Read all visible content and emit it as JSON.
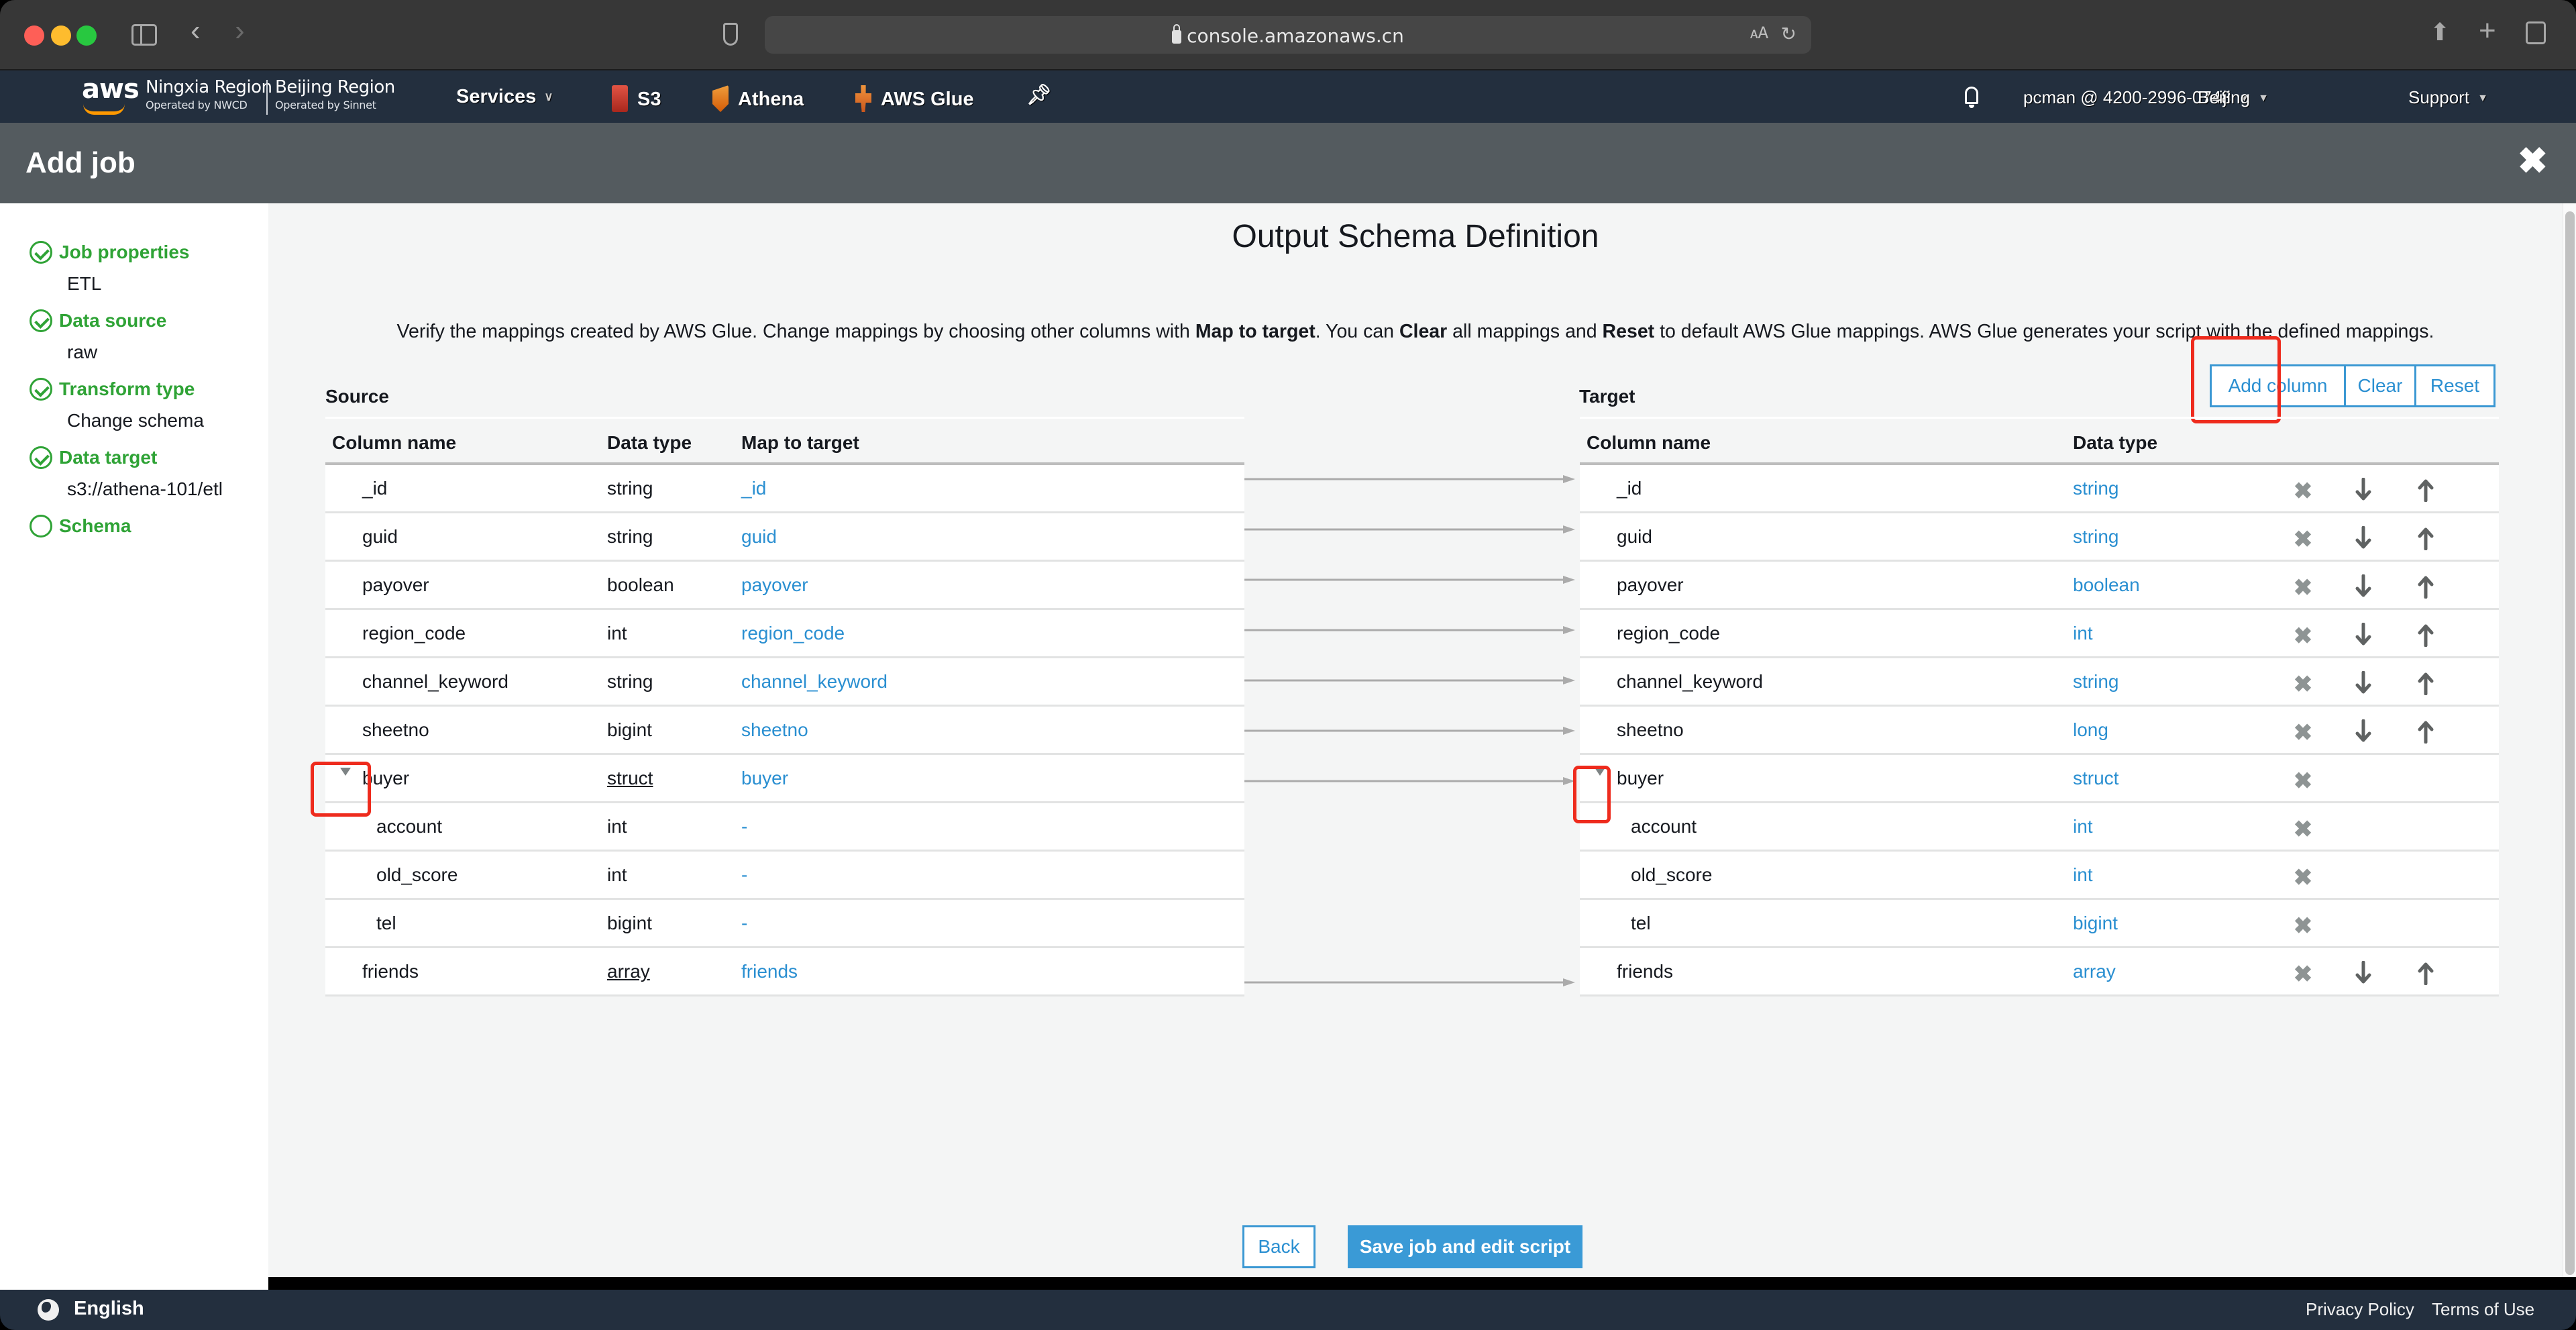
{
  "browser": {
    "url": "console.amazonaws.cn"
  },
  "awsnav": {
    "logo": "aws",
    "regions": [
      {
        "name": "Ningxia Region",
        "operator": "Operated by NWCD"
      },
      {
        "name": "Beijing Region",
        "operator": "Operated by Sinnet"
      }
    ],
    "services_label": "Services",
    "shortcuts": [
      "S3",
      "Athena",
      "AWS Glue"
    ],
    "account": "pcman @ 4200-2996-0748",
    "region": "Beijing",
    "support": "Support"
  },
  "header": {
    "title": "Add job",
    "close_icon": "close-icon"
  },
  "sidebar": {
    "steps": [
      {
        "label": "Job properties",
        "value": "ETL",
        "done": true
      },
      {
        "label": "Data source",
        "value": "raw",
        "done": true
      },
      {
        "label": "Transform type",
        "value": "Change schema",
        "done": true
      },
      {
        "label": "Data target",
        "value": "s3://athena-101/etl",
        "done": true
      },
      {
        "label": "Schema",
        "value": "",
        "done": false
      }
    ]
  },
  "main": {
    "title": "Output Schema Definition",
    "description": {
      "p1": "Verify the mappings created by AWS Glue. Change mappings by choosing other columns with ",
      "b1": "Map to target",
      "p2": ". You can ",
      "b2": "Clear",
      "p3": " all mappings and ",
      "b3": "Reset",
      "p4": " to default AWS Glue mappings. AWS Glue generates your script with the defined mappings."
    },
    "source_label": "Source",
    "target_label": "Target",
    "buttons": {
      "add_column": "Add column",
      "clear": "Clear",
      "reset": "Reset",
      "back": "Back",
      "save": "Save job and edit script"
    },
    "source_headers": [
      "Column name",
      "Data type",
      "Map to target"
    ],
    "target_headers": [
      "Column name",
      "Data type"
    ],
    "source_rows": [
      {
        "name": "_id",
        "type": "string",
        "map": "_id"
      },
      {
        "name": "guid",
        "type": "string",
        "map": "guid"
      },
      {
        "name": "payover",
        "type": "boolean",
        "map": "payover"
      },
      {
        "name": "region_code",
        "type": "int",
        "map": "region_code"
      },
      {
        "name": "channel_keyword",
        "type": "string",
        "map": "channel_keyword"
      },
      {
        "name": "sheetno",
        "type": "bigint",
        "map": "sheetno"
      },
      {
        "name": "buyer",
        "type": "struct",
        "map": "buyer"
      },
      {
        "name": "account",
        "type": "int",
        "map": "-"
      },
      {
        "name": "old_score",
        "type": "int",
        "map": "-"
      },
      {
        "name": "tel",
        "type": "bigint",
        "map": "-"
      },
      {
        "name": "friends",
        "type": "array",
        "map": "friends"
      }
    ],
    "target_rows": [
      {
        "name": "_id",
        "type": "string"
      },
      {
        "name": "guid",
        "type": "string"
      },
      {
        "name": "payover",
        "type": "boolean"
      },
      {
        "name": "region_code",
        "type": "int"
      },
      {
        "name": "channel_keyword",
        "type": "string"
      },
      {
        "name": "sheetno",
        "type": "long"
      },
      {
        "name": "buyer",
        "type": "struct"
      },
      {
        "name": "account",
        "type": "int"
      },
      {
        "name": "old_score",
        "type": "int"
      },
      {
        "name": "tel",
        "type": "bigint"
      },
      {
        "name": "friends",
        "type": "array"
      }
    ]
  },
  "footer": {
    "language": "English",
    "privacy": "Privacy Policy",
    "terms": "Terms of Use"
  },
  "colors": {
    "accent": "#2a8fd1",
    "success": "#2fa336",
    "nav_bg": "#232f3e",
    "header_bg": "#545b5f",
    "annotation": "#ee2b1d"
  }
}
